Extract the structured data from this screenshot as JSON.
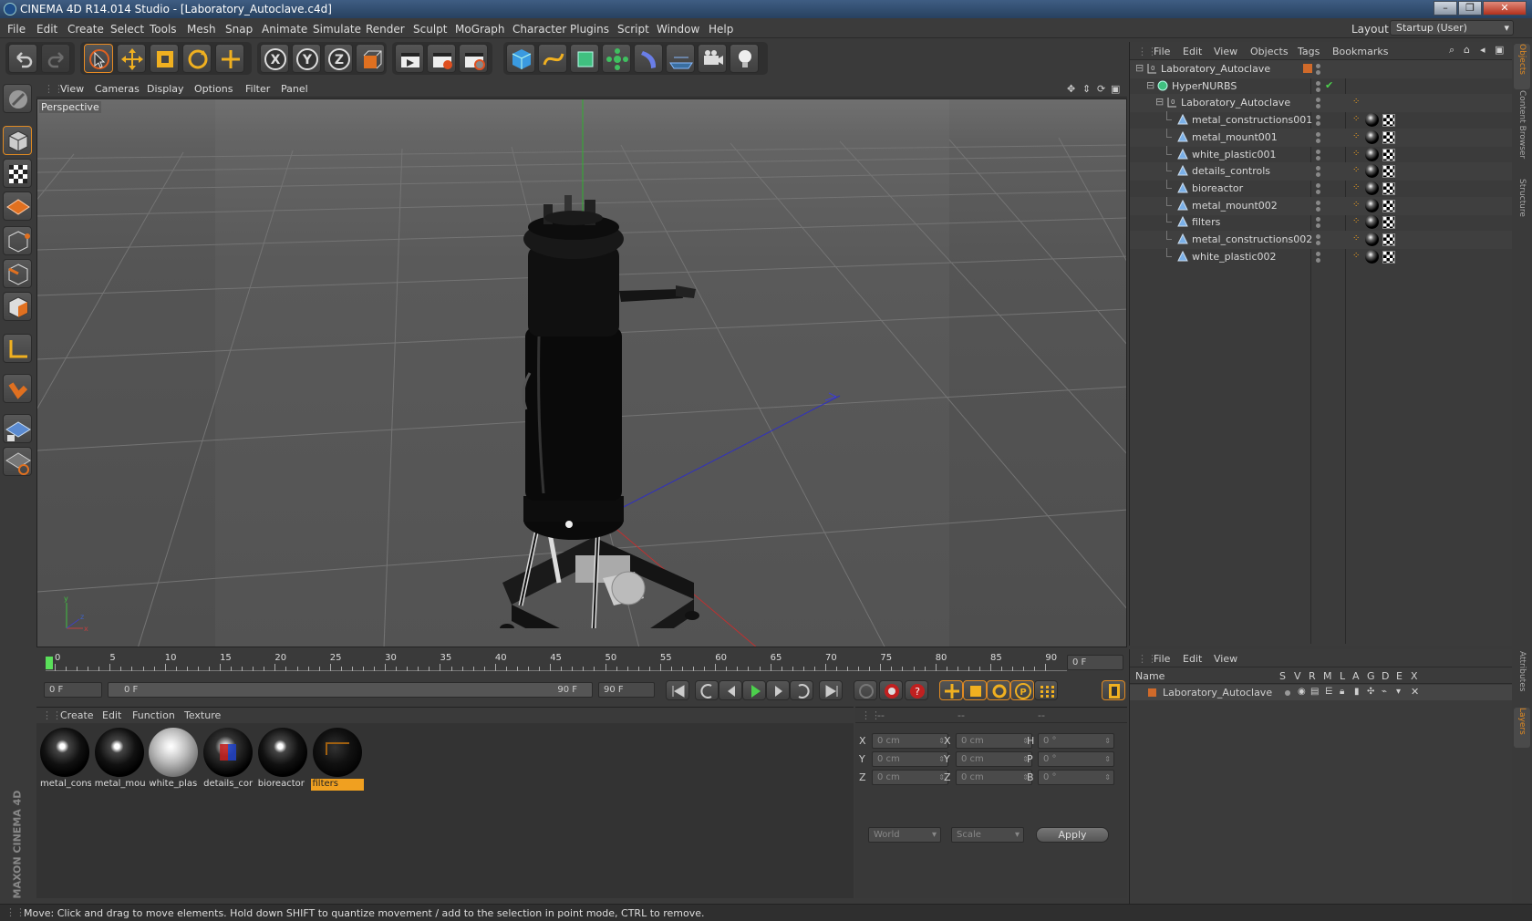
{
  "app": {
    "title": "CINEMA 4D R14.014 Studio - [Laboratory_Autoclave.c4d]",
    "layout_label": "Layout:",
    "layout_value": "Startup (User)"
  },
  "menu": [
    "File",
    "Edit",
    "Create",
    "Select",
    "Tools",
    "Mesh",
    "Snap",
    "Animate",
    "Simulate",
    "Render",
    "Sculpt",
    "MoGraph",
    "Character",
    "Plugins",
    "Script",
    "Window",
    "Help"
  ],
  "toolbar": {
    "icons": [
      "undo-icon",
      "redo-icon",
      "live-select-icon",
      "move-icon",
      "scale-icon",
      "rotate-icon",
      "add-icon",
      "x-axis-icon",
      "y-axis-icon",
      "z-axis-icon",
      "coordinate-system-icon",
      "render-view-icon",
      "render-picture-viewer-icon",
      "render-settings-icon",
      "cube-icon",
      "spline-icon",
      "nurbs-icon",
      "array-icon",
      "deformer-icon",
      "floor-icon",
      "camera-icon",
      "light-icon"
    ],
    "axis_x": "X",
    "axis_y": "Y",
    "axis_z": "Z"
  },
  "viewport": {
    "menu": [
      "View",
      "Cameras",
      "Display",
      "Options",
      "Filter",
      "Panel"
    ],
    "label": "Perspective",
    "axis_x": "x",
    "axis_y": "y",
    "axis_z": "z"
  },
  "timeline": {
    "ticks": [
      "0",
      "5",
      "10",
      "15",
      "20",
      "25",
      "30",
      "35",
      "40",
      "45",
      "50",
      "55",
      "60",
      "65",
      "70",
      "75",
      "80",
      "85",
      "90"
    ],
    "current_frame": "0 F"
  },
  "transport": {
    "start": "0 F",
    "range_start": "0 F",
    "range_end": "90 F",
    "end": "90 F"
  },
  "material_manager": {
    "menu": [
      "Create",
      "Edit",
      "Function",
      "Texture"
    ],
    "materials": [
      {
        "label": "metal_cons",
        "style": "black"
      },
      {
        "label": "metal_mou",
        "style": "black"
      },
      {
        "label": "white_plas",
        "style": "white"
      },
      {
        "label": "details_cor",
        "style": "details"
      },
      {
        "label": "bioreactor",
        "style": "black"
      },
      {
        "label": "filters",
        "style": "dark",
        "selected": true
      }
    ]
  },
  "coordinates": {
    "header": [
      "--",
      "--",
      "--"
    ],
    "rows": [
      {
        "a": "X",
        "av": "0 cm",
        "b": "X",
        "bv": "0 cm",
        "c": "H",
        "cv": "0 °"
      },
      {
        "a": "Y",
        "av": "0 cm",
        "b": "Y",
        "bv": "0 cm",
        "c": "P",
        "cv": "0 °"
      },
      {
        "a": "Z",
        "av": "0 cm",
        "b": "Z",
        "bv": "0 cm",
        "c": "B",
        "cv": "0 °"
      }
    ],
    "space": "World",
    "mode": "Scale",
    "apply": "Apply"
  },
  "object_manager": {
    "menu": [
      "File",
      "Edit",
      "View",
      "Objects",
      "Tags",
      "Bookmarks"
    ],
    "objects": [
      {
        "name": "Laboratory_Autoclave",
        "indent": 0,
        "type": "null"
      },
      {
        "name": "HyperNURBS",
        "indent": 1,
        "type": "nurbs"
      },
      {
        "name": "Laboratory_Autoclave",
        "indent": 2,
        "type": "null"
      },
      {
        "name": "metal_constructions001",
        "indent": 3,
        "type": "poly"
      },
      {
        "name": "metal_mount001",
        "indent": 3,
        "type": "poly"
      },
      {
        "name": "white_plastic001",
        "indent": 3,
        "type": "poly"
      },
      {
        "name": "details_controls",
        "indent": 3,
        "type": "poly"
      },
      {
        "name": "bioreactor",
        "indent": 3,
        "type": "poly"
      },
      {
        "name": "metal_mount002",
        "indent": 3,
        "type": "poly"
      },
      {
        "name": "filters",
        "indent": 3,
        "type": "poly"
      },
      {
        "name": "metal_constructions002",
        "indent": 3,
        "type": "poly"
      },
      {
        "name": "white_plastic002",
        "indent": 3,
        "type": "poly"
      }
    ]
  },
  "layer_manager": {
    "menu": [
      "File",
      "Edit",
      "View"
    ],
    "columns": [
      "Name",
      "S",
      "V",
      "R",
      "M",
      "L",
      "A",
      "G",
      "D",
      "E",
      "X"
    ],
    "layers": [
      {
        "name": "Laboratory_Autoclave",
        "color": "#d06a2a"
      }
    ]
  },
  "right_tabs": [
    "Objects",
    "Content Browser",
    "Structure",
    "Attributes",
    "Layers"
  ],
  "brand": "MAXON CINEMA 4D",
  "status": "Move: Click and drag to move elements. Hold down SHIFT to quantize movement / add to the selection in point mode, CTRL to remove."
}
